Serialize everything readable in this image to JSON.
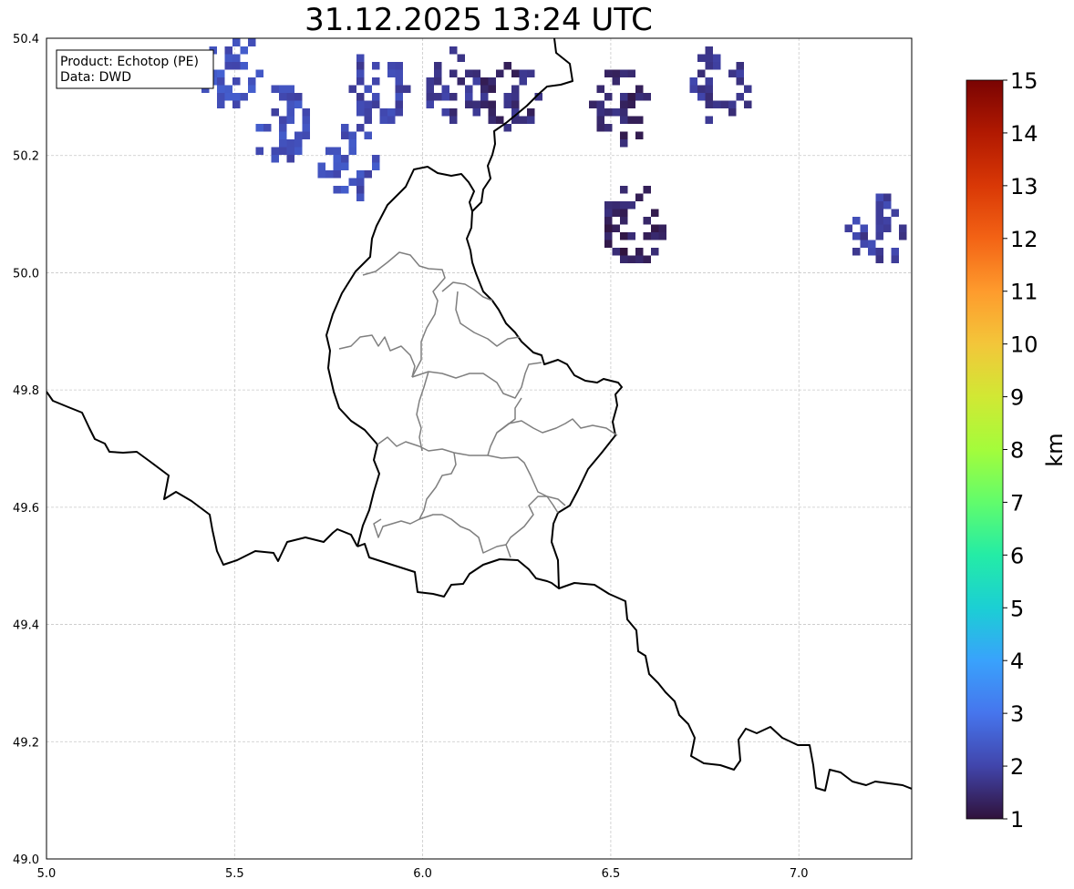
{
  "title": "31.12.2025 13:24 UTC",
  "info_box": {
    "product": "Product: Echotop (PE)",
    "data": "Data: DWD"
  },
  "map": {
    "lon_range": [
      5.0,
      7.3
    ],
    "lat_range": [
      49.0,
      50.4
    ],
    "x_ticks": [
      "5.0",
      "5.5",
      "6.0",
      "6.5",
      "7.0"
    ],
    "x_tick_values": [
      5.0,
      5.5,
      6.0,
      6.5,
      7.0
    ],
    "y_ticks": [
      "50.4",
      "50.2",
      "50.0",
      "49.8",
      "49.6",
      "49.4",
      "49.2",
      "49.0"
    ],
    "y_tick_values": [
      50.4,
      50.2,
      50.0,
      49.8,
      49.6,
      49.4,
      49.2,
      49.0
    ],
    "grid": true,
    "grid_style": "dashed light gray"
  },
  "colorbar": {
    "label": "km",
    "min": 1,
    "max": 15,
    "ticks": [
      "15",
      "14",
      "13",
      "12",
      "11",
      "10",
      "9",
      "8",
      "7",
      "6",
      "5",
      "4",
      "3",
      "2",
      "1"
    ],
    "colormap": "turbo",
    "stops": [
      "#30123b",
      "#4145ab",
      "#4675ed",
      "#39a2fc",
      "#1bcfd4",
      "#24eca6",
      "#61fc6c",
      "#a4fc3b",
      "#d1e834",
      "#f3c63a",
      "#fe9b2d",
      "#f36315",
      "#d93806",
      "#b11901",
      "#7a0403"
    ]
  },
  "echo_clusters": [
    {
      "lon": 5.48,
      "lat": 50.35,
      "echotop_km": 2.3
    },
    {
      "lon": 5.62,
      "lat": 50.26,
      "echotop_km": 2.2
    },
    {
      "lon": 5.8,
      "lat": 50.19,
      "echotop_km": 2.2
    },
    {
      "lon": 5.87,
      "lat": 50.32,
      "echotop_km": 2.0
    },
    {
      "lon": 6.07,
      "lat": 50.32,
      "echotop_km": 1.7
    },
    {
      "lon": 6.22,
      "lat": 50.31,
      "echotop_km": 1.5
    },
    {
      "lon": 6.52,
      "lat": 50.29,
      "echotop_km": 1.4
    },
    {
      "lon": 6.55,
      "lat": 50.09,
      "echotop_km": 1.3
    },
    {
      "lon": 6.78,
      "lat": 50.33,
      "echotop_km": 1.8
    },
    {
      "lon": 7.2,
      "lat": 50.08,
      "echotop_km": 1.9
    }
  ],
  "colors": {
    "border": "#000000",
    "canton_border": "#7f7f7f",
    "grid": "#c8c8c8"
  }
}
